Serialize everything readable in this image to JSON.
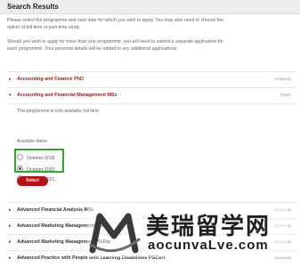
{
  "header": {
    "title": "Search Results"
  },
  "intro": {
    "p1": "Please select the programme and start date for which you wish to apply. You may also need to choose the option of full-time or part-time study.",
    "p2": "Should you wish to apply for more than one programme, you will need to submit a separate application for each programme. Your personal details will be added to any additional applications."
  },
  "programmes": [
    {
      "name": "Accounting and Finance PhD",
      "toggle": "(expand)"
    },
    {
      "name": "Accounting and Financial Management MSc",
      "toggle": "(hide)"
    },
    {
      "name": "Advanced Financial Analysis MSc",
      "toggle": "(expand)"
    },
    {
      "name": "Advanced Marketing Management MSc",
      "toggle": "(expand)"
    },
    {
      "name": "Advanced Marketing Management PGDip",
      "toggle": "(expand)"
    },
    {
      "name": "Advanced Practice with People with Learning Disabilities PGCert",
      "toggle": "(expand)"
    }
  ],
  "panel": {
    "note": "This programme is only available full time.",
    "available_label": "Available dates",
    "options": [
      "October 2019",
      "October 2020",
      "October 2021"
    ],
    "selected_index": 1,
    "select_button": "Select"
  },
  "watermark": {
    "title": "美瑞留学网",
    "url": "aocunvaLve.com",
    "colors": {
      "m_icon": "#3a3a3a"
    }
  },
  "colors": {
    "accent": "#b3121b",
    "highlight_box": "#2ea82e"
  }
}
